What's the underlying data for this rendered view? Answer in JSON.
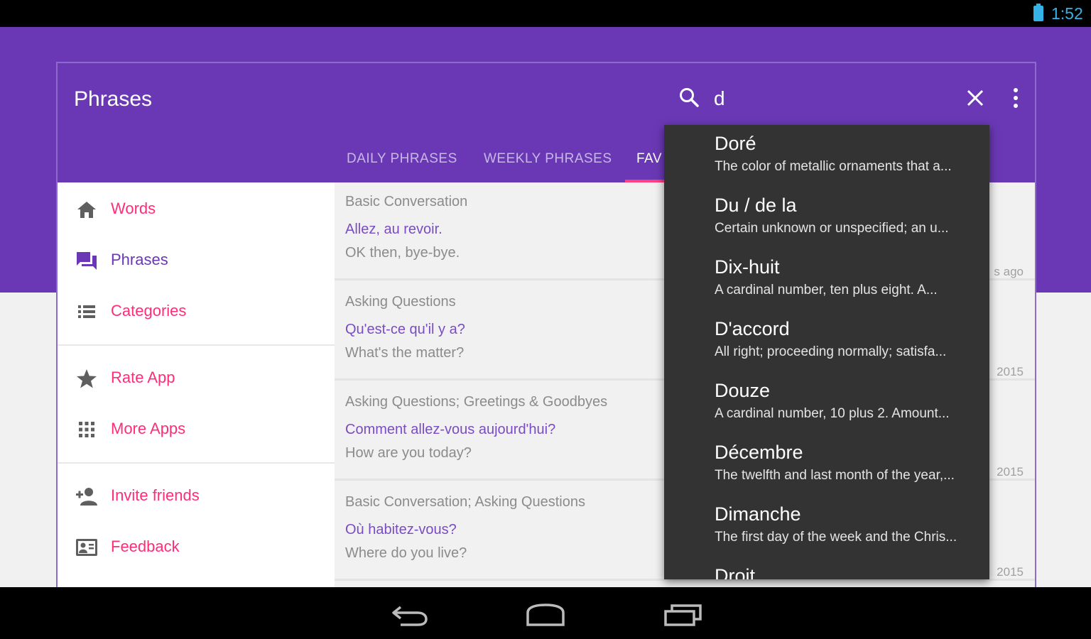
{
  "status_bar": {
    "time": "1:52",
    "battery_icon": "battery-icon",
    "accent_color": "#36b3e6"
  },
  "app_bar": {
    "title": "Phrases",
    "search_value": "d",
    "icons": [
      "search-icon",
      "close-icon",
      "overflow-menu-icon"
    ],
    "color": "#6a38b5"
  },
  "tabs": [
    {
      "label": "DAILY PHRASES"
    },
    {
      "label": "WEEKLY PHRASES"
    },
    {
      "label": "FAV",
      "active": true
    }
  ],
  "drawer": {
    "items": [
      {
        "label": "Words",
        "icon": "home-icon"
      },
      {
        "label": "Phrases",
        "icon": "chat-bubbles-icon",
        "active": true
      },
      {
        "label": "Categories",
        "icon": "list-icon"
      },
      {
        "label": "Rate App",
        "icon": "star-icon"
      },
      {
        "label": "More Apps",
        "icon": "apps-grid-icon"
      },
      {
        "label": "Invite friends",
        "icon": "add-person-icon"
      },
      {
        "label": "Feedback",
        "icon": "feedback-icon"
      }
    ]
  },
  "phrases": [
    {
      "category": "Basic Conversation",
      "french": "Allez, au revoir.",
      "english": "OK then, bye-bye.",
      "meta": "s ago"
    },
    {
      "category": "Asking Questions",
      "french": "Qu'est-ce qu'il y a?",
      "english": "What's the matter?",
      "meta": "2015"
    },
    {
      "category": "Asking Questions; Greetings & Goodbyes",
      "french": "Comment allez-vous aujourd'hui?",
      "english": "How are you today?",
      "meta": "2015"
    },
    {
      "category": "Basic Conversation; Asking Questions",
      "french": "Où habitez-vous?",
      "english": "Where do you live?",
      "meta": "2015"
    }
  ],
  "suggestions": [
    {
      "word": "Doré",
      "definition": "The color of metallic ornaments that a..."
    },
    {
      "word": "Du / de la",
      "definition": "Certain unknown or unspecified; an u..."
    },
    {
      "word": "Dix-huit",
      "definition": "A cardinal number, ten plus eight.   A..."
    },
    {
      "word": "D'accord",
      "definition": "All right; proceeding normally; satisfa..."
    },
    {
      "word": "Douze",
      "definition": "A cardinal number, 10 plus 2. Amount..."
    },
    {
      "word": "Décembre",
      "definition": "The twelfth and last month of the year,..."
    },
    {
      "word": "Dimanche",
      "definition": "The first day of the week and the Chris..."
    },
    {
      "word": "Droit",
      "definition": ""
    }
  ],
  "nav_bar": {
    "icons": [
      "back-icon",
      "home-icon",
      "recents-icon"
    ]
  }
}
